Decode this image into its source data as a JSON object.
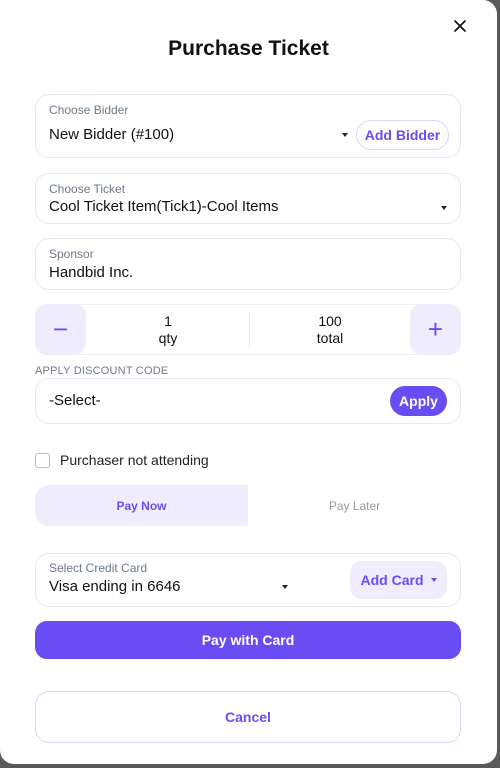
{
  "modal": {
    "title": "Purchase Ticket",
    "close_icon": "close-icon"
  },
  "bidder": {
    "label": "Choose Bidder",
    "value": "New Bidder (#100)",
    "add_button": "Add Bidder"
  },
  "ticket": {
    "label": "Choose Ticket",
    "value": "Cool Ticket Item(Tick1)-Cool Items"
  },
  "sponsor": {
    "label": "Sponsor",
    "value": "Handbid Inc."
  },
  "quantity": {
    "decrement_symbol": "−",
    "increment_symbol": "+",
    "qty_value": "1",
    "qty_label": "qty",
    "total_value": "100",
    "total_label": "total"
  },
  "discount": {
    "section_label": "APPLY DISCOUNT CODE",
    "value": "-Select-",
    "apply_button": "Apply"
  },
  "attendance": {
    "label": "Purchaser not attending",
    "checked": false
  },
  "payment_tabs": {
    "items": [
      {
        "label": "Pay Now",
        "active": true
      },
      {
        "label": "Pay Later",
        "active": false
      }
    ]
  },
  "credit_card": {
    "label": "Select Credit Card",
    "value": "Visa ending in 6646",
    "add_button": "Add Card"
  },
  "actions": {
    "pay_button": "Pay with Card",
    "cancel_button": "Cancel"
  },
  "colors": {
    "accent": "#6a4cf5",
    "accent_light": "#efecfd",
    "backdrop": "#5a5a5a"
  }
}
